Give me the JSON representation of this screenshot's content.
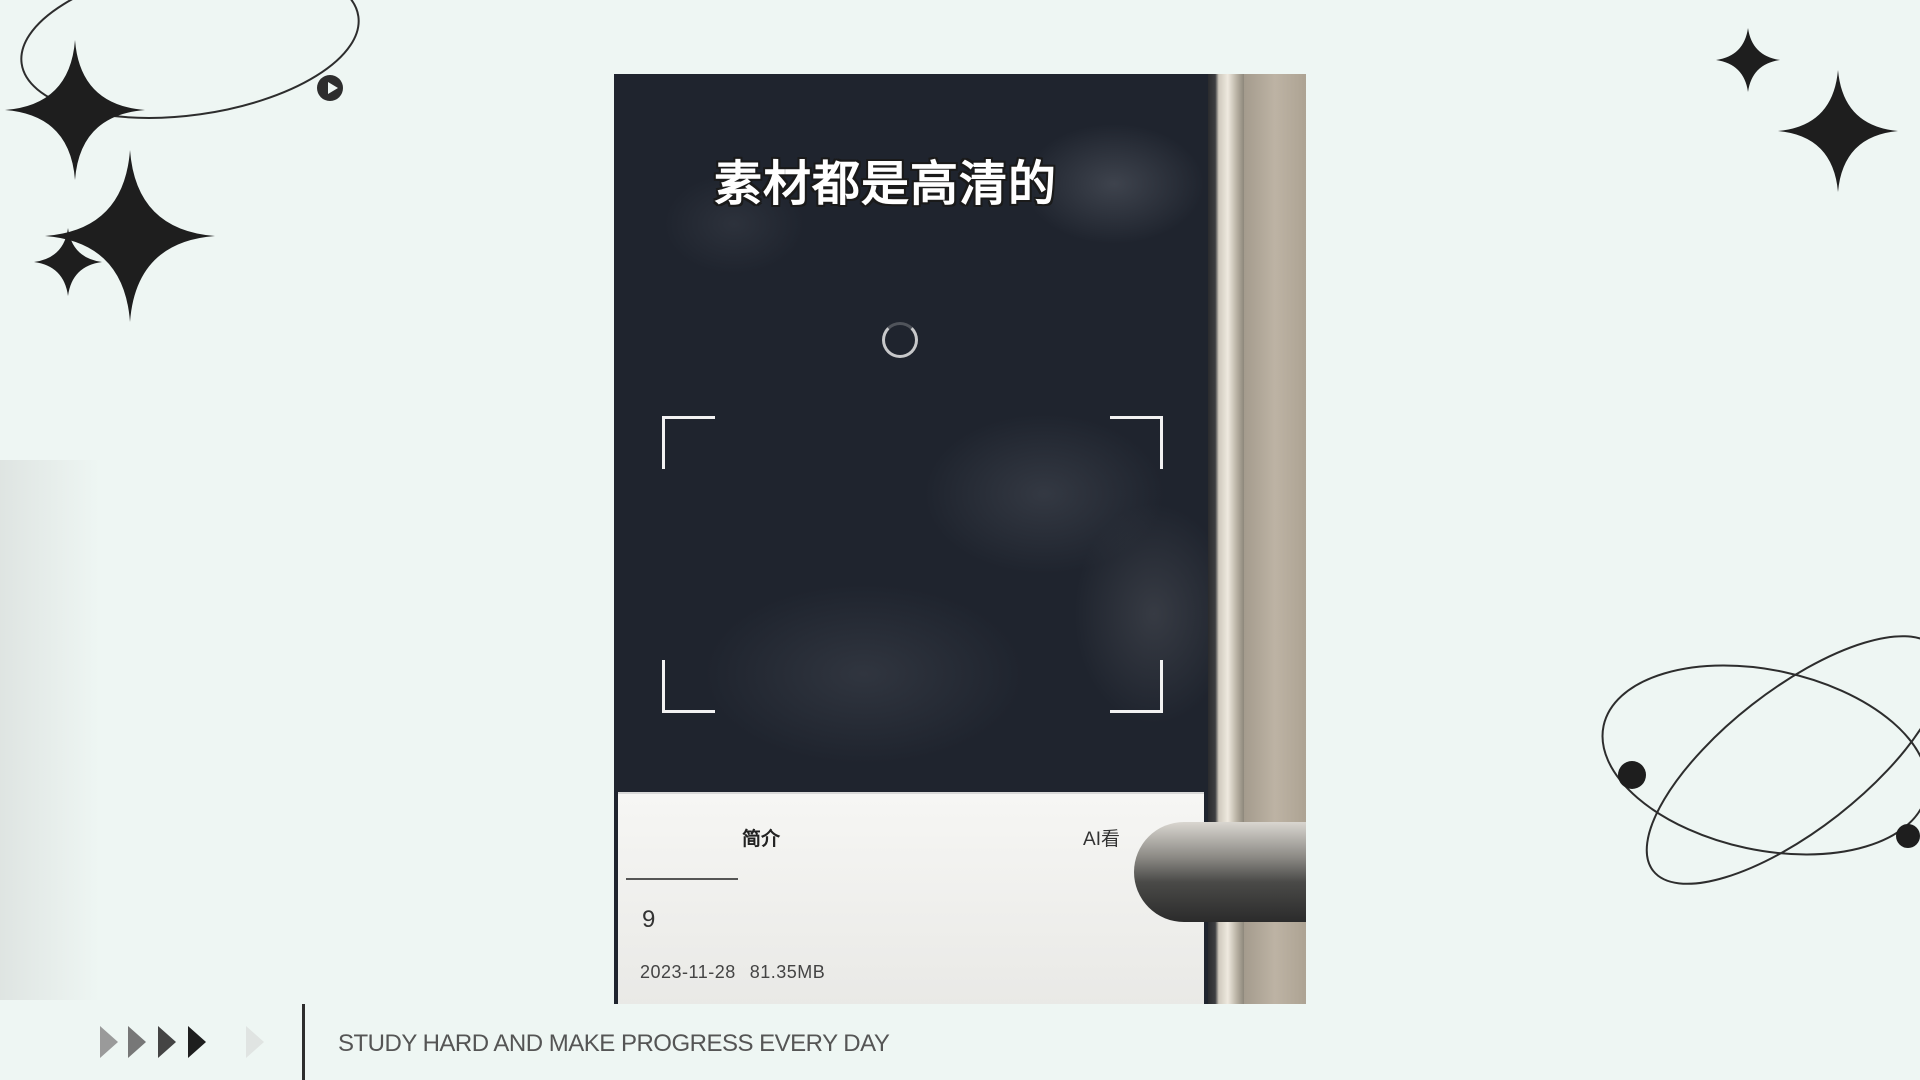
{
  "footer": {
    "slogan": "STUDY HARD AND MAKE PROGRESS EVERY DAY"
  },
  "video_panel": {
    "tab_intro": "简介",
    "tab_ai": "AI看",
    "subtitle": "素材都是高清的",
    "episode_number": "9",
    "date": "2023-11-28",
    "file_size": "81.35MB"
  },
  "icons": {
    "loading": "loading-ring-icon",
    "frame_corners": "focus-frame-icon",
    "stars": "sparkle-star-icon",
    "orbits": "orbit-ring-icon",
    "arrows": "play-arrow-icon"
  },
  "colors": {
    "background": "#eef6f3",
    "screen": "#1f242e",
    "ink": "#2d2d2d"
  }
}
